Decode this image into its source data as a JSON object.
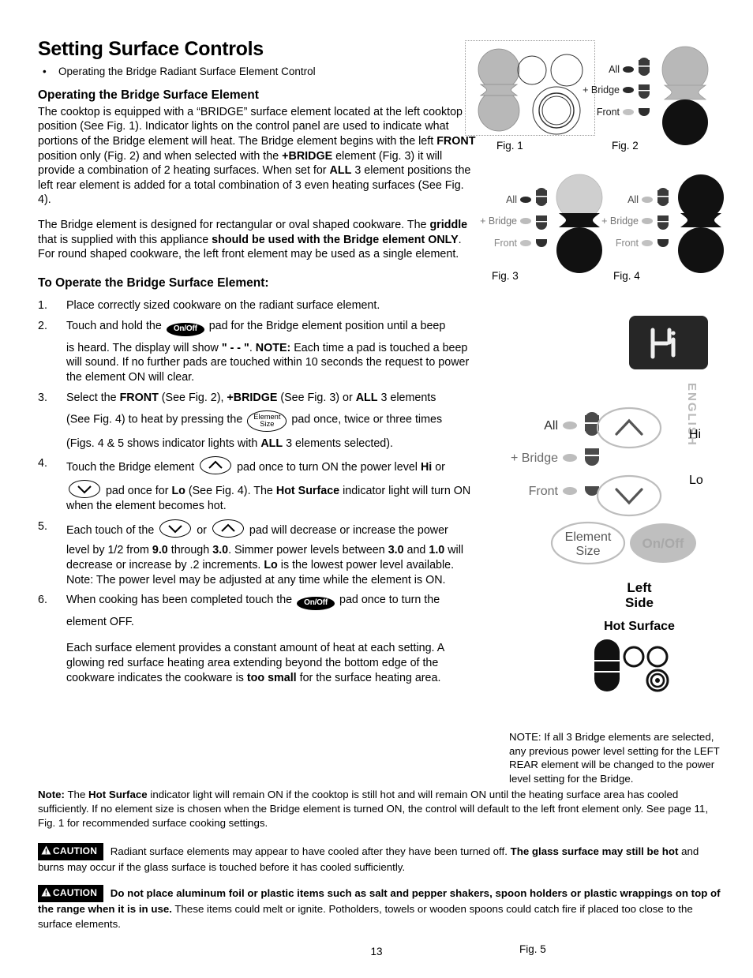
{
  "document": {
    "title": "Setting Surface Controls",
    "bullet": "Operating the Bridge Radiant Surface Element Control",
    "page_number": "13",
    "side_tab": "ENGLISH"
  },
  "section_operating": {
    "heading": "Operating the Bridge Surface Element",
    "para1_a": "The cooktop is equipped with a “BRIDGE” surface element located at the left cooktop position (See Fig. 1). Indicator lights on the control panel are used to indicate what portions of the Bridge element will heat. The Bridge element begins with the left ",
    "para1_b": "FRONT",
    "para1_c": " position only (Fig. 2) and when selected with the ",
    "para1_d": "+BRIDGE",
    "para1_e": " element (Fig. 3) it will provide a combination of 2 heating surfaces. When set for ",
    "para1_f": "ALL",
    "para1_g": " 3 element positions the left rear element is added for a total combination of 3 even heating surfaces (See Fig. 4).",
    "para2_a": "The Bridge element is designed for rectangular or oval shaped cookware. The ",
    "para2_b": "griddle",
    "para2_c": " that is supplied with this appliance ",
    "para2_d": "should be used with the Bridge element ONLY",
    "para2_e": ". For round shaped cookware, the left front element may be used as a single element."
  },
  "section_operate": {
    "heading": "To Operate the Bridge Surface Element:",
    "steps": [
      {
        "num": "1.",
        "text": "Place correctly sized cookware on the radiant surface element."
      },
      {
        "num": "2.",
        "pre": "Touch and hold the ",
        "pad": "On/Off",
        "post": " pad for the Bridge element position until a beep",
        "sub_a": "is heard. The display will show ",
        "sub_b": "\" - - \"",
        "sub_c": ". ",
        "sub_d": "NOTE:",
        "sub_e": " Each time a pad is touched a beep will sound. If no further pads are touched within 10 seconds the request to power the element ON will clear."
      },
      {
        "num": "3.",
        "pre": "Select the ",
        "b1": "FRONT",
        "mid1": " (See Fig. 2), ",
        "b2": "+BRIDGE",
        "mid2": " (See Fig. 3) or ",
        "b3": "ALL",
        "post": " 3 elements",
        "sub_pre": "(See Fig. 4) to heat by pressing the ",
        "pad_line1": "Element",
        "pad_line2": "Size",
        "sub_post": " pad once, twice or three times",
        "sub2_pre": "(Figs. 4 & 5 shows indicator lights with ",
        "sub2_b": "ALL",
        "sub2_post": " 3 elements selected)."
      },
      {
        "num": "4.",
        "pre": "Touch the Bridge element ",
        "pad": "up-arrow",
        "mid": " pad once to turn ON the power level ",
        "b1": "Hi",
        "post": " or",
        "sub_pad": "down-arrow",
        "sub_pre": " pad once for ",
        "sub_b1": "Lo",
        "sub_mid": " (See Fig. 4). The ",
        "sub_b2": "Hot Surface",
        "sub_post": " indicator light will turn ON when the element becomes hot."
      },
      {
        "num": "5.",
        "pre": "Each touch of the ",
        "pad1": "down-arrow",
        "mid": " or ",
        "pad2": "up-arrow",
        "post": " pad will decrease or increase the power",
        "sub_a": "level by 1/2 from ",
        "sub_b1": "9.0",
        "sub_b": " through ",
        "sub_b2": "3.0",
        "sub_c": ". Simmer power levels between ",
        "sub_b3": "3.0",
        "sub_d": " and ",
        "sub_b4": "1.0",
        "sub_e": " will decrease or increase by .2 increments. ",
        "sub_b5": "Lo",
        "sub_f": " is the lowest power level available. Note: The power level may be adjusted at any time while the element is ON."
      },
      {
        "num": "6.",
        "pre": "When cooking has been completed touch the ",
        "pad": "On/Off",
        "post": " pad once to turn the",
        "sub": "element OFF.",
        "extra_a": "Each surface element provides a constant amount of heat at each setting. A glowing red surface heating area extending beyond the bottom edge of the cookware indicates the cookware is ",
        "extra_b": "too small",
        "extra_c": " for the surface heating area."
      }
    ]
  },
  "bottom_note": {
    "label": "Note:",
    "a": " The ",
    "b": "Hot Surface",
    "c": " indicator light will remain ON if the cooktop is still hot and will remain ON until the heating surface area has cooled sufficiently. If no element size is chosen when the Bridge element is turned ON, the control will default to the left front element only. See page 11, Fig. 1 for recommended surface cooking settings."
  },
  "cautions": [
    {
      "badge": "CAUTION",
      "a": " Radiant surface elements may appear to have cooled after they have been turned off. ",
      "b": "The glass surface may still be hot",
      "c": " and burns may occur if the glass surface is touched before it has cooled sufficiently."
    },
    {
      "badge": "CAUTION",
      "a": " ",
      "b": "Do not place aluminum foil or plastic items such as salt and pepper shakers, spoon holders or plastic wrappings on top of the range when it is in use.",
      "c": " These items could melt or ignite. Potholders, towels or wooden spoons could catch fire if placed too close to the surface elements."
    }
  ],
  "figures": {
    "fig1": {
      "caption": "Fig. 1"
    },
    "fig2": {
      "caption": "Fig. 2",
      "labels": [
        "All",
        "+Bridge",
        "Front"
      ],
      "lit": [
        "Front"
      ]
    },
    "fig3": {
      "caption": "Fig. 3",
      "labels": [
        "All",
        "+Bridge",
        "Front"
      ],
      "lit": [
        "+Bridge",
        "Front"
      ]
    },
    "fig4": {
      "caption": "Fig. 4",
      "labels": [
        "All",
        "+Bridge",
        "Front"
      ],
      "lit": [
        "All",
        "+Bridge",
        "Front"
      ]
    },
    "fig5": {
      "caption": "Fig. 5",
      "display_value": "Hi",
      "labels": [
        "All",
        "+Bridge",
        "Front"
      ],
      "hi_label": "Hi",
      "lo_label": "Lo",
      "element_size_line1": "Element",
      "element_size_line2": "Size",
      "onoff_label": "On/Off",
      "side_line1": "Left",
      "side_line2": "Side",
      "hot_surface": "Hot Surface"
    }
  },
  "note_right": {
    "text": "NOTE: If all 3 Bridge elements are selected, any previous power level setting for the LEFT REAR element will be changed to the power level setting for the Bridge."
  },
  "colors": {
    "ink": "#000000",
    "dark_fill": "#1a1a1a",
    "gray_hatch": "#b0b0b0",
    "display_bg": "#262626"
  }
}
